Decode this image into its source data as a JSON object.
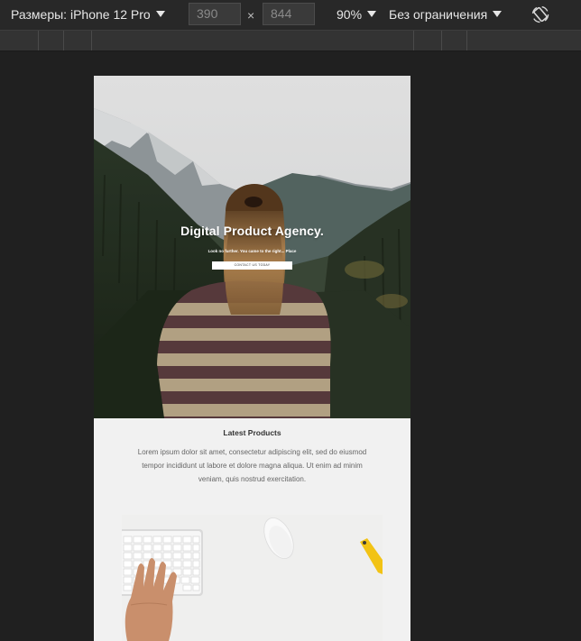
{
  "toolbar": {
    "dimensions_label": "Размеры: iPhone 12 Pro",
    "width_value": "390",
    "height_value": "844",
    "times_symbol": "×",
    "zoom_label": "90%",
    "throttle_label": "Без ограничения",
    "rotate_icon": "rotate-icon"
  },
  "hero": {
    "title": "Digital Product Agency.",
    "subtitle": "Look no further. You came to the right... Place",
    "button_label": "CONTACT US TODAY"
  },
  "section": {
    "title": "Latest Products",
    "text": "Lorem ipsum dolor sit amet, consectetur adipiscing elit, sed do eiusmod tempor incididunt ut labore et dolore magna aliqua. Ut enim ad minim veniam, quis nostrud exercitation."
  },
  "colors": {
    "toolbar_bg": "#282828",
    "page_bg": "#202020",
    "device_bg": "#f1f1f1"
  }
}
